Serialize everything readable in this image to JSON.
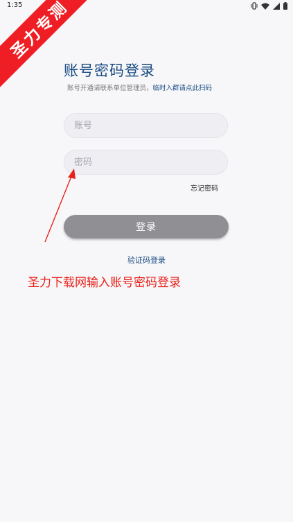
{
  "status_bar": {
    "time": "1:35",
    "icons": [
      "vibrate-icon",
      "wifi-icon",
      "signal-icon",
      "battery-icon"
    ]
  },
  "watermark": {
    "text": "圣力专测",
    "color": "#ef1e24"
  },
  "login": {
    "title": "账号密码登录",
    "subtitle_prefix": "账号开通请联系单位管理员，",
    "subtitle_link": "临时入群请点此扫码",
    "account_placeholder": "账号",
    "account_value": "",
    "password_placeholder": "密码",
    "password_value": "",
    "forgot_password": "忘记密码",
    "login_button": "登录",
    "alt_login": "验证码登录"
  },
  "annotation": {
    "text": "圣力下载网输入账号密码登录",
    "color": "#e8211a"
  },
  "colors": {
    "accent": "#184a82",
    "background": "#f7f7f9",
    "button": "#909094"
  }
}
